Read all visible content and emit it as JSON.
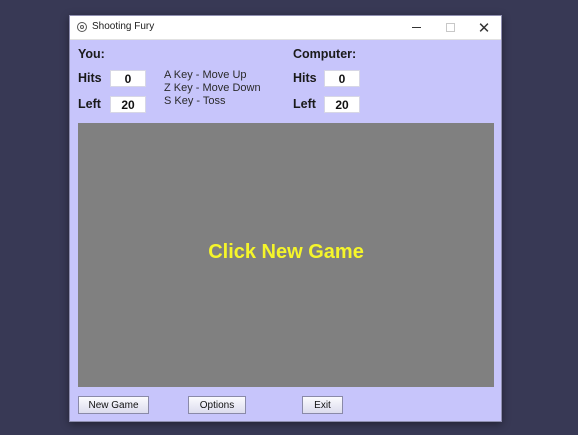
{
  "window": {
    "title": "Shooting Fury",
    "controls": {
      "minimize": "minimize-icon",
      "maximize": "maximize-icon",
      "close": "✕"
    }
  },
  "player": {
    "heading": "You:",
    "hits_label": "Hits",
    "hits_value": "0",
    "left_label": "Left",
    "left_value": "20"
  },
  "instructions": [
    "A Key - Move Up",
    "Z Key - Move Down",
    "S Key - Toss"
  ],
  "computer": {
    "heading": "Computer:",
    "hits_label": "Hits",
    "hits_value": "0",
    "left_label": "Left",
    "left_value": "20"
  },
  "game": {
    "message": "Click New Game",
    "message_color": "#f5f52a",
    "background": "#808080"
  },
  "buttons": {
    "new_game": "New Game",
    "options": "Options",
    "exit": "Exit"
  },
  "colors": {
    "desktop": "#383955",
    "window_bg": "#c7c5fb"
  }
}
